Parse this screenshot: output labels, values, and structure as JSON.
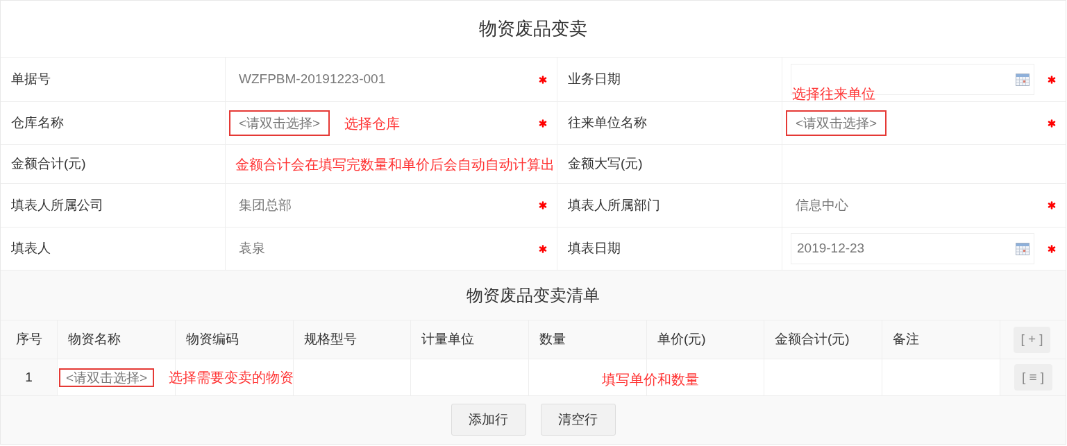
{
  "title": "物资废品变卖",
  "form": {
    "rows": [
      {
        "fields": [
          {
            "label": "单据号",
            "kind": "text",
            "value": "WZFPBM-20191223-001",
            "required": true
          },
          {
            "label": "业务日期",
            "kind": "date",
            "required": true
          }
        ]
      },
      {
        "fields": [
          {
            "label": "仓库名称",
            "kind": "picker",
            "placeholder": "<请双击选择>",
            "highlighted": true,
            "required": true,
            "note": {
              "kind": "after",
              "text": "选择仓库"
            }
          },
          {
            "label": "往来单位名称",
            "kind": "picker",
            "placeholder": "<请双击选择>",
            "highlighted": true,
            "required": true,
            "note": {
              "kind": "above",
              "text": "选择往来单位"
            }
          }
        ]
      },
      {
        "fields": [
          {
            "label": "金额合计(元)",
            "kind": "text",
            "required": false,
            "note": {
              "kind": "inline",
              "text": "金额合计会在填写完数量和单价后会自动自动计算出"
            }
          },
          {
            "label": "金额大写(元)",
            "kind": "text",
            "required": false
          }
        ]
      },
      {
        "fields": [
          {
            "label": "填表人所属公司",
            "kind": "text",
            "value": "集团总部",
            "required": true
          },
          {
            "label": "填表人所属部门",
            "kind": "text",
            "value": "信息中心",
            "required": true
          }
        ]
      },
      {
        "fields": [
          {
            "label": "填表人",
            "kind": "text",
            "value": "袁泉",
            "required": true
          },
          {
            "label": "填表日期",
            "kind": "date",
            "value": "2019-12-23",
            "required": true
          }
        ]
      }
    ]
  },
  "list": {
    "title": "物资废品变卖清单",
    "columns": [
      "序号",
      "物资名称",
      "物资编码",
      "规格型号",
      "计量单位",
      "数量",
      "单价(元)",
      "金额合计(元)",
      "备注"
    ],
    "add_button": "[ + ]",
    "rows": [
      {
        "cells": [
          {
            "kind": "index",
            "value": "1"
          },
          {
            "kind": "picker",
            "placeholder": "<请双击选择>",
            "highlighted": true,
            "note": {
              "kind": "after",
              "text": "选择需要变卖的物资"
            }
          },
          {
            "kind": "text"
          },
          {
            "kind": "text"
          },
          {
            "kind": "text"
          },
          {
            "kind": "text"
          },
          {
            "kind": "text",
            "note": {
              "kind": "over",
              "text": "填写单价和数量"
            }
          },
          {
            "kind": "text"
          },
          {
            "kind": "text"
          }
        ],
        "menu_button": "[ ≡ ]"
      }
    ]
  },
  "buttons": [
    "添加行",
    "清空行"
  ]
}
